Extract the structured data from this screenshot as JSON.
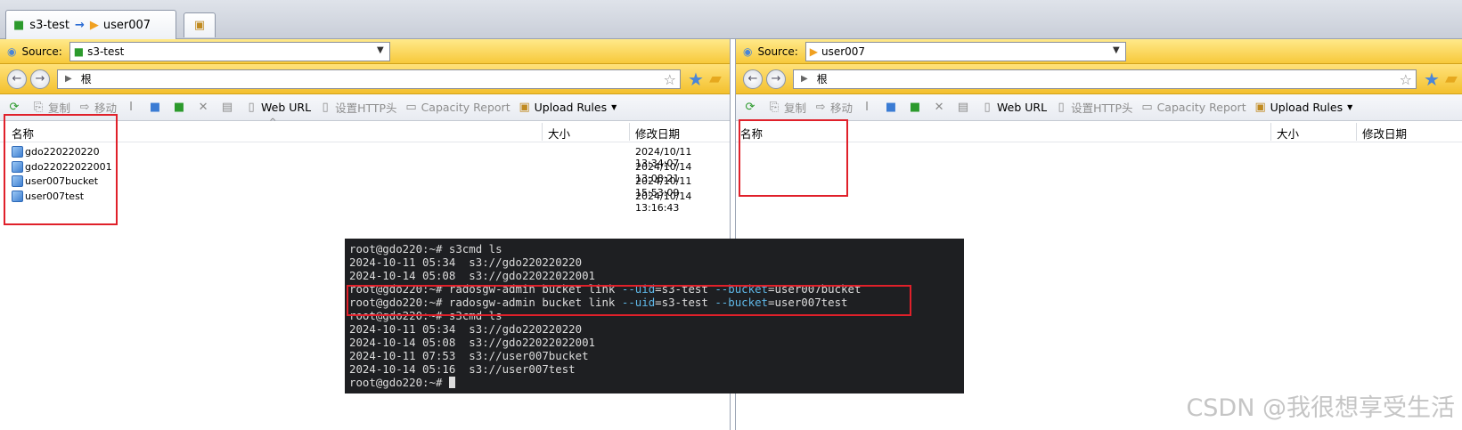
{
  "window": {
    "tab": {
      "source": "s3-test",
      "arrow": "→",
      "target": "user007"
    }
  },
  "left_pane": {
    "source_label": "Source:",
    "source_value": "s3-test",
    "address": "根",
    "toolbar": [
      "复制",
      "移动",
      "Web URL",
      "设置HTTP头",
      "Capacity Report",
      "Upload Rules"
    ],
    "columns": {
      "name": "名称",
      "size": "大小",
      "modified": "修改日期"
    },
    "rows": [
      {
        "name": "gdo220220220",
        "modified": "2024/10/11 13:34:07"
      },
      {
        "name": "gdo22022022001",
        "modified": "2024/10/14 13:08:21"
      },
      {
        "name": "user007bucket",
        "modified": "2024/10/11 15:53:09"
      },
      {
        "name": "user007test",
        "modified": "2024/10/14 13:16:43"
      }
    ]
  },
  "right_pane": {
    "source_label": "Source:",
    "source_value": "user007",
    "address": "根",
    "toolbar": [
      "复制",
      "移动",
      "Web URL",
      "设置HTTP头",
      "Capacity Report",
      "Upload Rules"
    ],
    "columns": {
      "name": "名称",
      "size": "大小",
      "modified": "修改日期"
    }
  },
  "terminal": {
    "lines": [
      "root@gdo220:~# s3cmd ls",
      "2024-10-11 05:34  s3://gdo220220220",
      "2024-10-14 05:08  s3://gdo22022022001",
      "root@gdo220:~# s3cmd ls",
      "2024-10-11 05:34  s3://gdo220220220",
      "2024-10-14 05:08  s3://gdo22022022001",
      "2024-10-11 07:53  s3://user007bucket",
      "2024-10-14 05:16  s3://user007test",
      "root@gdo220:~# "
    ],
    "link_cmds": [
      {
        "prompt": "root@gdo220:~# radosgw-admin bucket link ",
        "uid_flag": "--uid",
        "uid_val": "=s3-test ",
        "bucket_flag": "--bucket",
        "bucket_val": "=user007bucket"
      },
      {
        "prompt": "root@gdo220:~# radosgw-admin bucket link ",
        "uid_flag": "--uid",
        "uid_val": "=s3-test ",
        "bucket_flag": "--bucket",
        "bucket_val": "=user007test"
      }
    ]
  },
  "watermark": "CSDN @我很想享受生活",
  "colors": {
    "highlight_box": "#e0202a",
    "terminal_bg": "#1e1f22",
    "flag_color": "#5fb8e8",
    "source_bar": "#f7c93b"
  }
}
